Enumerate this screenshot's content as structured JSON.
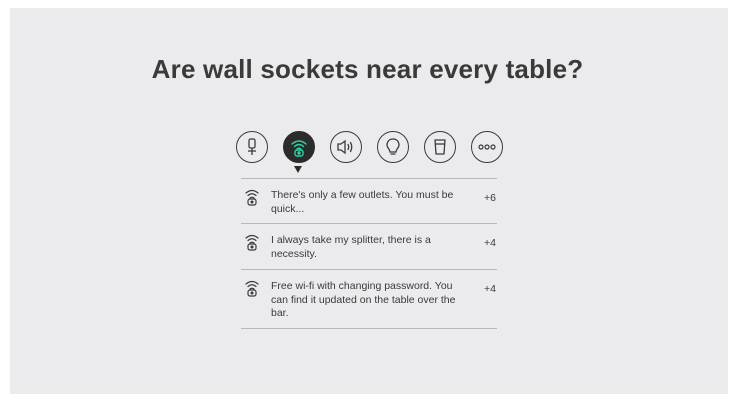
{
  "heading": "Are wall sockets near every table?",
  "categories": [
    {
      "id": "microphone",
      "icon": "microphone-stand-icon",
      "active": false
    },
    {
      "id": "wifi",
      "icon": "wifi-router-icon",
      "active": true
    },
    {
      "id": "sound",
      "icon": "speaker-icon",
      "active": false
    },
    {
      "id": "lighting",
      "icon": "lightbulb-icon",
      "active": false
    },
    {
      "id": "drinks",
      "icon": "cup-icon",
      "active": false
    },
    {
      "id": "more",
      "icon": "more-dots-icon",
      "active": false
    }
  ],
  "accent_color": "#2bd3a3",
  "comments": [
    {
      "icon": "wifi-router-icon",
      "text": "There's only a few outlets. You must be quick...",
      "score": "+6"
    },
    {
      "icon": "wifi-router-icon",
      "text": "I always take my splitter, there is a necessity.",
      "score": "+4"
    },
    {
      "icon": "wifi-router-icon",
      "text": "Free wi-fi with changing password. You can find it updated on the table over the bar.",
      "score": "+4"
    }
  ]
}
